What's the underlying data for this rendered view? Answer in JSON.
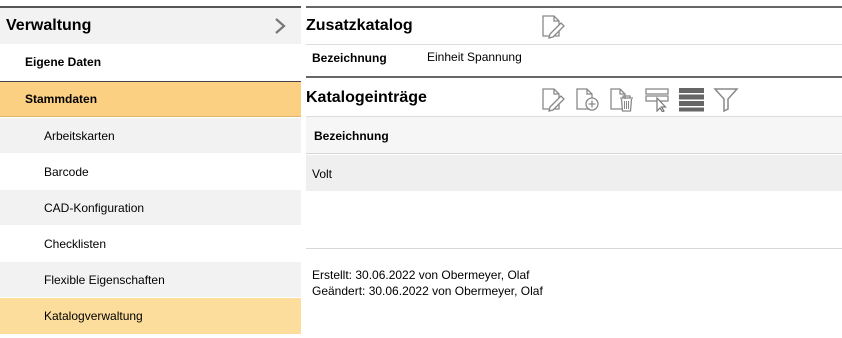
{
  "sidebar": {
    "title": "Verwaltung",
    "expand_icon": "chevron-right-icon",
    "items": [
      {
        "label": "Eigene Daten"
      },
      {
        "label": "Stammdaten"
      },
      {
        "label": "Arbeitskarten"
      },
      {
        "label": "Barcode"
      },
      {
        "label": "CAD-Konfiguration"
      },
      {
        "label": "Checklisten"
      },
      {
        "label": "Flexible Eigenschaften"
      },
      {
        "label": "Katalogverwaltung"
      }
    ],
    "colors": {
      "active_parent": "#fcd082",
      "active_child": "#fcdd9c",
      "header_bg": "#f2f2f2"
    }
  },
  "catalog": {
    "title": "Zusatzkatalog",
    "edit_icon": "edit-icon",
    "field_label": "Bezeichnung",
    "field_value": "Einheit Spannung"
  },
  "entries": {
    "title": "Katalogeinträge",
    "toolbar_icons": [
      "edit-icon",
      "add-document-icon",
      "delete-icon",
      "select-column-icon",
      "rows-icon",
      "filter-icon"
    ],
    "column_header": "Bezeichnung",
    "rows": [
      {
        "bezeichnung": "Volt"
      }
    ]
  },
  "meta": {
    "created": "Erstellt:  30.06.2022 von Obermeyer, Olaf",
    "modified": "Geändert:  30.06.2022 von Obermeyer, Olaf"
  }
}
